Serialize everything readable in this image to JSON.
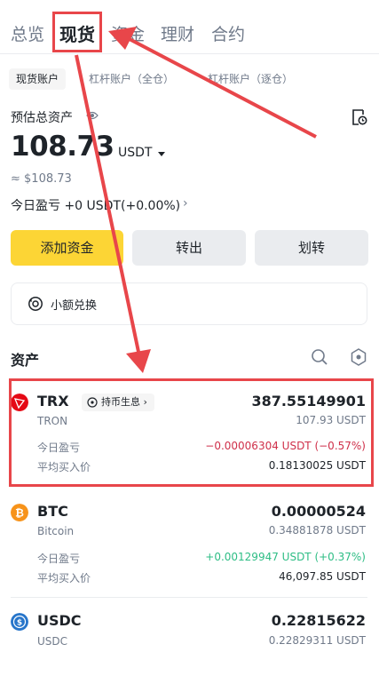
{
  "nav": {
    "tabs": [
      "总览",
      "现货",
      "资金",
      "理财",
      "合约"
    ],
    "active_index": 1
  },
  "sub_tabs": [
    "现货账户",
    "杠杆账户（全仓）",
    "杠杆账户（逐仓）"
  ],
  "overview": {
    "estimated_label": "预估总资产",
    "balance": "108.73",
    "unit": "USDT",
    "approx": "≈ $108.73",
    "today_pnl": "今日盈亏 +0 USDT(+0.00%)"
  },
  "buttons": {
    "add_funds": "添加资金",
    "withdraw": "转出",
    "transfer": "划转"
  },
  "small_exchange": {
    "label": "小额兑换"
  },
  "assets": {
    "title": "资产",
    "pnl_label": "今日盈亏",
    "avg_price_label": "平均买入价",
    "items": [
      {
        "symbol": "TRX",
        "name": "TRON",
        "badge": "持币生息",
        "amount": "387.55149901",
        "value": "107.93 USDT",
        "pnl": "−0.00006304 USDT (−0.57%)",
        "avg_price": "0.18130025 USDT",
        "icon_color": "#e50915"
      },
      {
        "symbol": "BTC",
        "name": "Bitcoin",
        "amount": "0.00000524",
        "value": "0.34881878 USDT",
        "pnl": "+0.00129947 USDT (+0.37%)",
        "avg_price": "46,097.85 USDT",
        "icon_color": "#f7931a"
      },
      {
        "symbol": "USDC",
        "name": "USDC",
        "amount": "0.22815622",
        "value": "0.22829311 USDT",
        "icon_color": "#2775ca"
      }
    ]
  },
  "colors": {
    "accent": "#fcd535",
    "negative": "#cf304a",
    "positive": "#2ebd85",
    "annotation": "#e8464a"
  }
}
